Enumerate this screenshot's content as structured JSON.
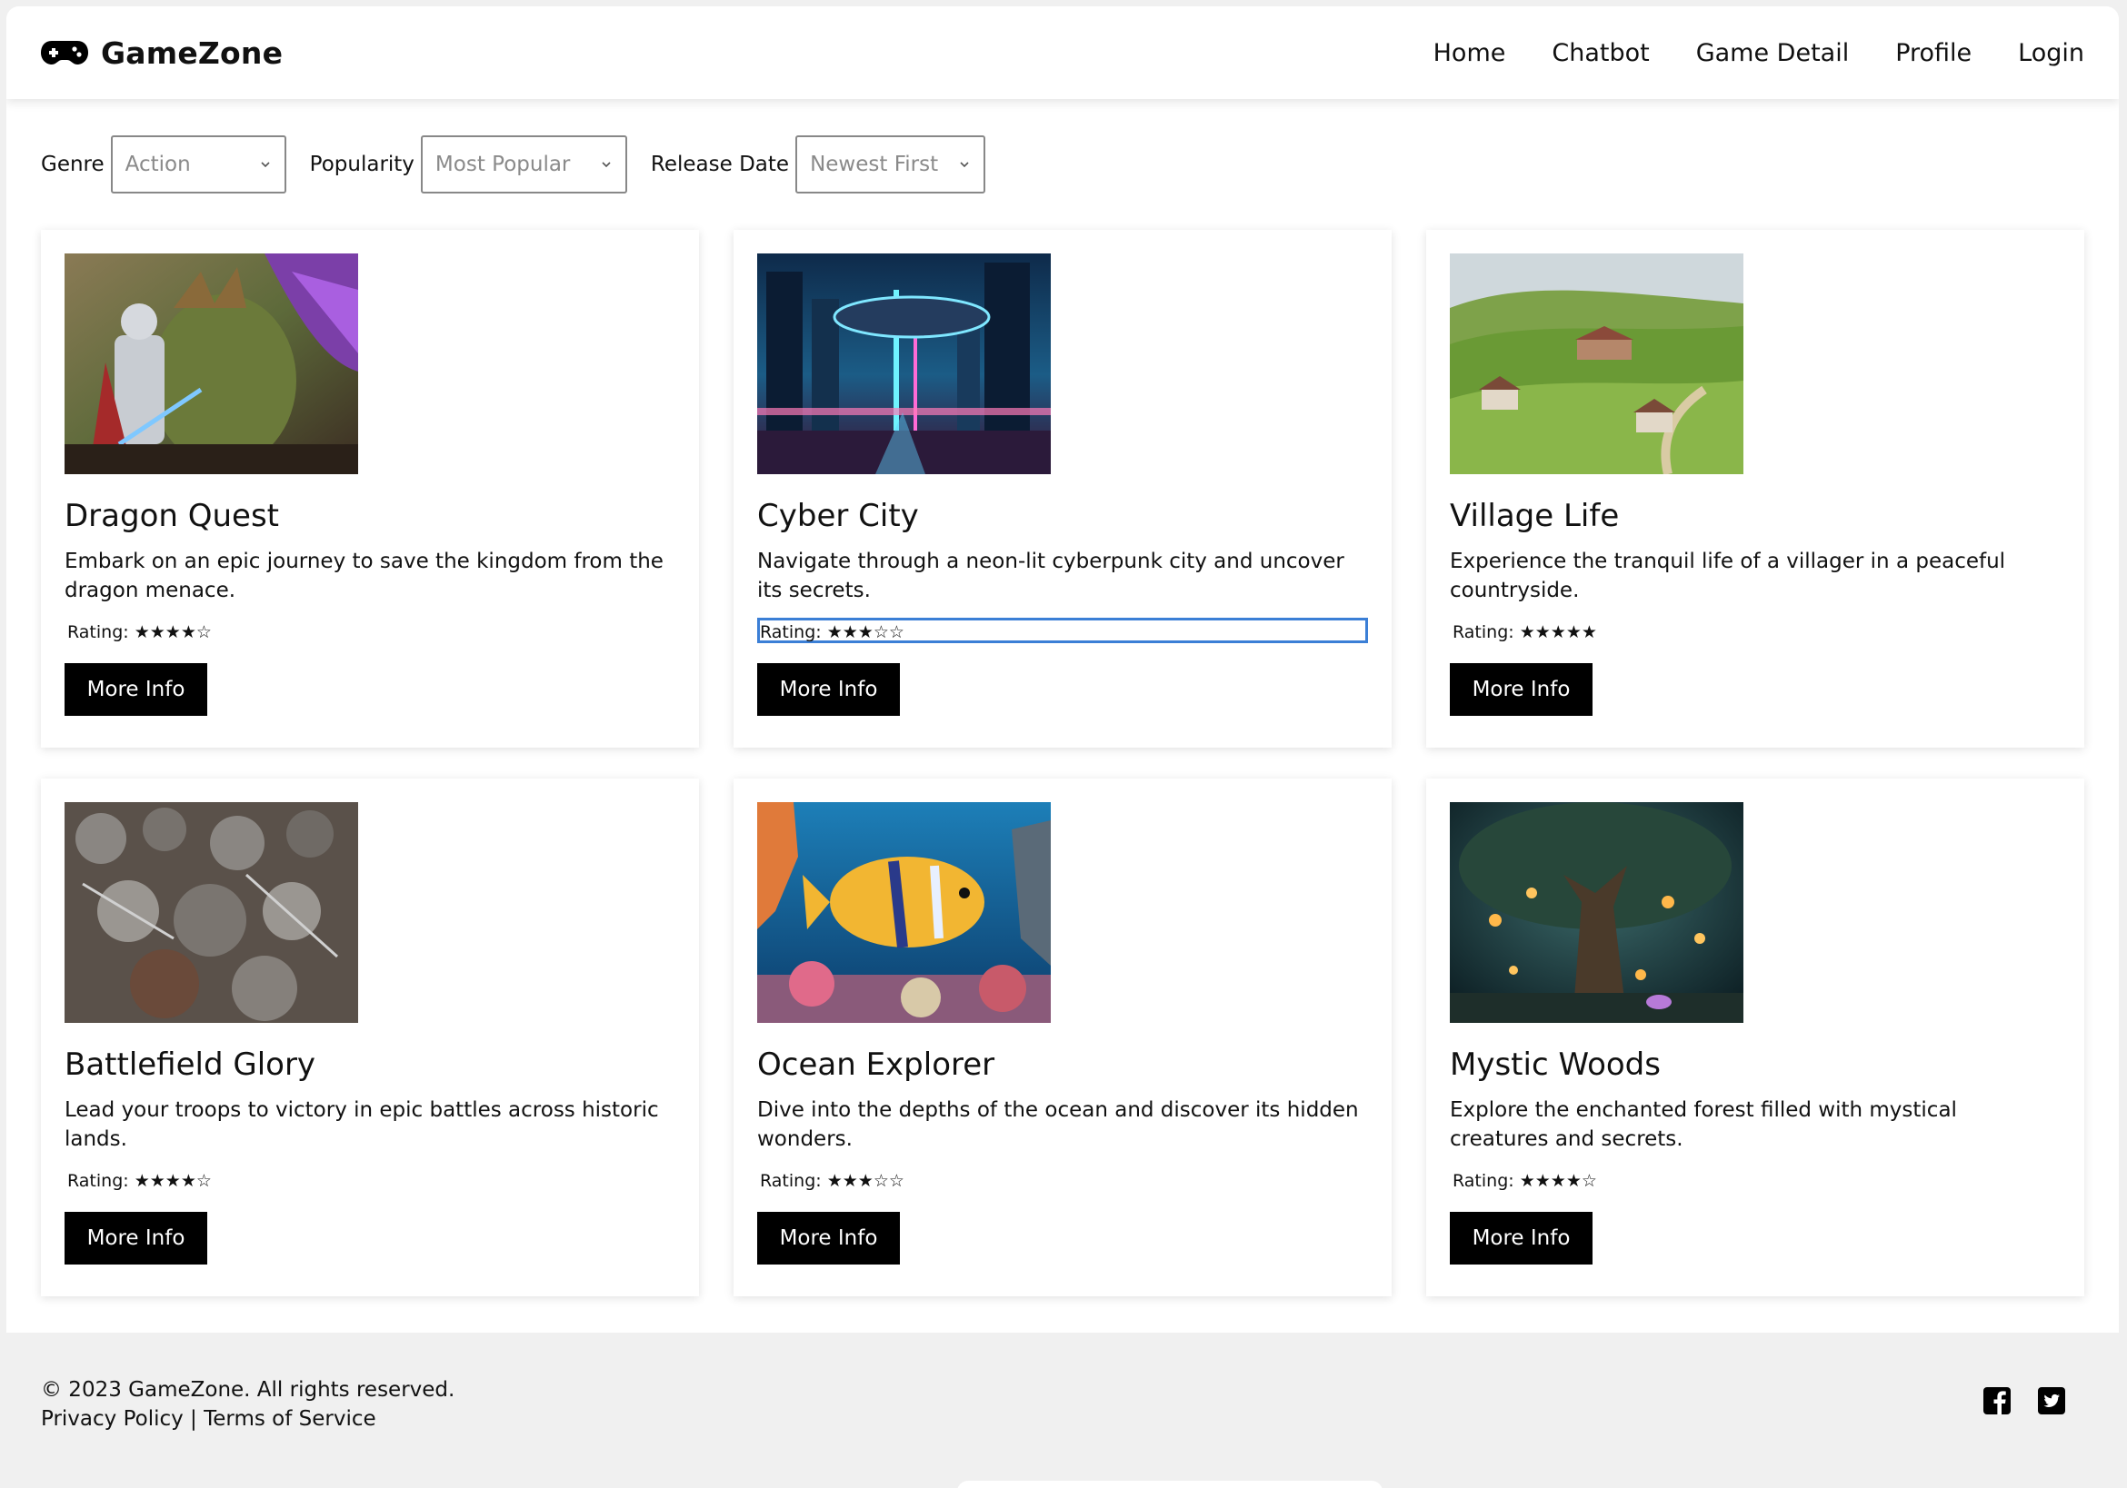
{
  "app": {
    "brand": "GameZone"
  },
  "nav": {
    "home": "Home",
    "chatbot": "Chatbot",
    "game_detail": "Game Detail",
    "profile": "Profile",
    "login": "Login"
  },
  "filters": {
    "genre": {
      "label": "Genre",
      "value": "Action"
    },
    "popularity": {
      "label": "Popularity",
      "value": "Most Popular"
    },
    "release_date": {
      "label": "Release Date",
      "value": "Newest First"
    }
  },
  "games": [
    {
      "title": "Dragon Quest",
      "description": "Embark on an epic journey to save the kingdom from the dragon menace.",
      "rating_label": "Rating:",
      "stars": "★★★★☆",
      "rating_value": 4,
      "button": "More Info"
    },
    {
      "title": "Cyber City",
      "description": "Navigate through a neon-lit cyberpunk city and uncover its secrets.",
      "rating_label": "Rating:",
      "stars": "★★★☆☆",
      "rating_value": 3,
      "button": "More Info"
    },
    {
      "title": "Village Life",
      "description": "Experience the tranquil life of a villager in a peaceful countryside.",
      "rating_label": "Rating:",
      "stars": "★★★★★",
      "rating_value": 5,
      "button": "More Info"
    },
    {
      "title": "Battlefield Glory",
      "description": "Lead your troops to victory in epic battles across historic lands.",
      "rating_label": "Rating:",
      "stars": "★★★★☆",
      "rating_value": 4,
      "button": "More Info"
    },
    {
      "title": "Ocean Explorer",
      "description": "Dive into the depths of the ocean and discover its hidden wonders.",
      "rating_label": "Rating:",
      "stars": "★★★☆☆",
      "rating_value": 3,
      "button": "More Info"
    },
    {
      "title": "Mystic Woods",
      "description": "Explore the enchanted forest filled with mystical creatures and secrets.",
      "rating_label": "Rating:",
      "stars": "★★★★☆",
      "rating_value": 4,
      "button": "More Info"
    }
  ],
  "footer": {
    "copyright": "© 2023 GameZone. All rights reserved.",
    "privacy": "Privacy Policy",
    "separator": " | ",
    "terms": "Terms of Service"
  },
  "icons": {
    "brand": "gamepad-icon",
    "social": [
      "facebook-icon",
      "twitter-icon"
    ]
  }
}
